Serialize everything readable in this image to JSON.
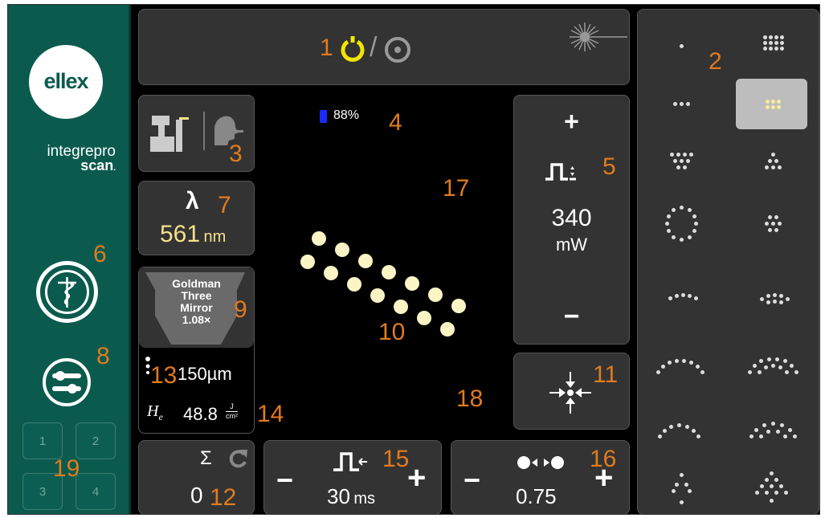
{
  "brand": {
    "logo": "ellex",
    "line1": "integrepro",
    "line2": "scan",
    "mark": "."
  },
  "top": {
    "label": "1",
    "divider": "/"
  },
  "battery": {
    "percent": "88%",
    "label": "4"
  },
  "mode_panel": {
    "label": "3"
  },
  "wavelength": {
    "symbol": "λ",
    "value": "561",
    "unit": "nm",
    "label": "7"
  },
  "lens": {
    "line1": "Goldman",
    "line2": "Three",
    "line3": "Mirror",
    "line4": "1.08×",
    "label": "9"
  },
  "spot": {
    "value": "150µm",
    "label": "13"
  },
  "fluence": {
    "symbol": "H",
    "subscript": "e",
    "value": "48.8",
    "unit_num": "J",
    "unit_den": "cm²",
    "label": "14"
  },
  "power": {
    "plus": "+",
    "minus": "−",
    "value": "340",
    "unit": "mW",
    "label": "5"
  },
  "center_btn": {
    "label": "11"
  },
  "counter": {
    "sigma": "Σ",
    "value": "0",
    "label": "12"
  },
  "duration": {
    "minus": "−",
    "plus": "+",
    "value": "30",
    "unit": "ms",
    "label": "15"
  },
  "spacing": {
    "minus": "−",
    "plus": "+",
    "value": "0.75",
    "label": "16"
  },
  "patterns": {
    "label": "2"
  },
  "treatment_pattern": {
    "label": "10"
  },
  "labels": {
    "l6": "6",
    "l8": "8",
    "l17": "17",
    "l18": "18",
    "l19": "19"
  },
  "memory": [
    "1",
    "2",
    "3",
    "4"
  ],
  "colors": {
    "sidebar": "#0b5a4e",
    "accent": "#e07b1e",
    "aim": "#f2e600",
    "spot": "#fbf4c4",
    "battery": "#1a2cff"
  }
}
